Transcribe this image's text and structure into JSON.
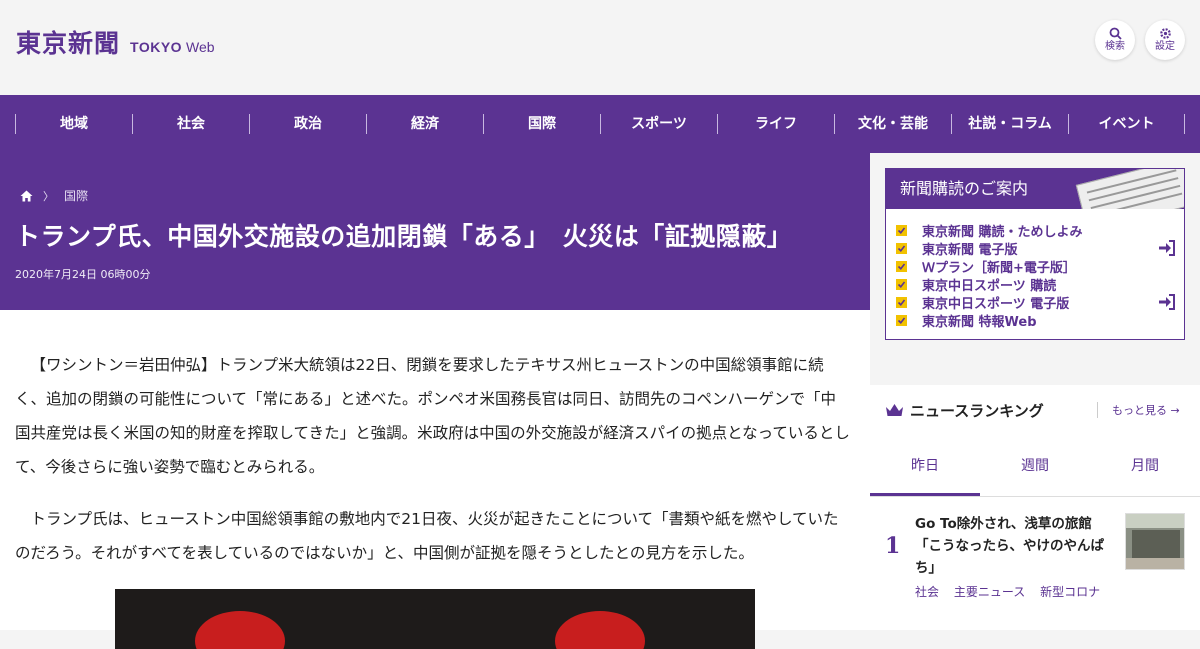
{
  "header": {
    "logo_jp": "東京新聞",
    "logo_tokyo": "TOKYO",
    "logo_web": "Web",
    "search_label": "検索",
    "settings_label": "設定"
  },
  "nav": {
    "items": [
      {
        "label": "地域"
      },
      {
        "label": "社会"
      },
      {
        "label": "政治"
      },
      {
        "label": "経済"
      },
      {
        "label": "国際"
      },
      {
        "label": "スポーツ"
      },
      {
        "label": "ライフ"
      },
      {
        "label": "文化・芸能"
      },
      {
        "label": "社説・コラム"
      },
      {
        "label": "イベント"
      }
    ]
  },
  "article": {
    "breadcrumb": {
      "section": "国際"
    },
    "title": "トランプ氏、中国外交施設の追加閉鎖「ある」　火災は「証拠隠蔽」",
    "date": "2020年7月24日 06時00分",
    "paragraphs": [
      "【ワシントン＝岩田仲弘】トランプ米大統領は22日、閉鎖を要求したテキサス州ヒューストンの中国総領事館に続く、追加の閉鎖の可能性について「常にある」と述べた。ポンペオ米国務長官は同日、訪問先のコペンハーゲンで「中国共産党は長く米国の知的財産を搾取してきた」と強調。米政府は中国の外交施設が経済スパイの拠点となっているとして、今後さらに強い姿勢で臨むとみられる。",
      "トランプ氏は、ヒューストン中国総領事館の敷地内で21日夜、火災が起きたことについて「書類や紙を燃やしていたのだろう。それがすべてを表しているのではないか」と、中国側が証拠を隠そうとしたとの見方を示した。"
    ]
  },
  "subscription": {
    "heading": "新聞購読のご案内",
    "items": [
      {
        "label": "東京新聞 購読・ためしよみ"
      },
      {
        "label": "東京新聞 電子版"
      },
      {
        "label": "Ｗプラン［新聞+電子版］"
      },
      {
        "label": "東京中日スポーツ 購読"
      },
      {
        "label": "東京中日スポーツ 電子版"
      },
      {
        "label": "東京新聞 特報Web"
      }
    ]
  },
  "ranking": {
    "title": "ニュースランキング",
    "more": "もっと見る",
    "tabs": [
      {
        "label": "昨日"
      },
      {
        "label": "週間"
      },
      {
        "label": "月間"
      }
    ],
    "items": [
      {
        "rank": "1",
        "title": "Go To除外され、浅草の旅館「こうなったら、やけのやんぱち」",
        "tags": [
          "社会",
          "主要ニュース",
          "新型コロナ"
        ]
      }
    ]
  },
  "colors": {
    "brand_purple": "#5b3392",
    "checkbox_yellow": "#f2c200"
  }
}
